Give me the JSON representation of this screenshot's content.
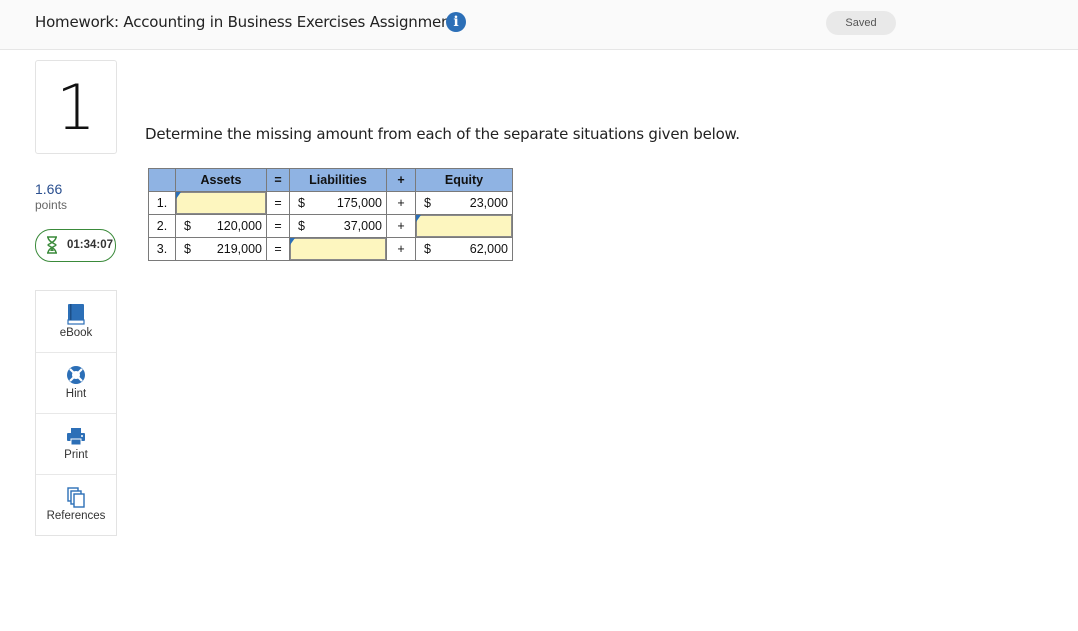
{
  "header": {
    "title": "Homework: Accounting in Business Exercises Assignment",
    "info_icon": "info-icon",
    "saved_label": "Saved"
  },
  "sidebar": {
    "question_number": "1",
    "points_value": "1.66",
    "points_label": "points",
    "timer": "01:34:07",
    "tools": [
      {
        "label": "eBook",
        "icon": "book-icon"
      },
      {
        "label": "Hint",
        "icon": "lifebuoy-icon"
      },
      {
        "label": "Print",
        "icon": "printer-icon"
      },
      {
        "label": "References",
        "icon": "documents-icon"
      }
    ]
  },
  "question": {
    "prompt": "Determine the missing amount from each of the separate situations given below.",
    "table": {
      "headers": {
        "assets": "Assets",
        "eq": "=",
        "liabilities": "Liabilities",
        "plus": "+",
        "equity": "Equity"
      },
      "rows": [
        {
          "num": "1.",
          "assets_cur": "",
          "assets": "",
          "eq": "=",
          "liab_cur": "$",
          "liabilities": "175,000",
          "plus": "+",
          "eq_cur": "$",
          "equity": "23,000"
        },
        {
          "num": "2.",
          "assets_cur": "$",
          "assets": "120,000",
          "eq": "=",
          "liab_cur": "$",
          "liabilities": "37,000",
          "plus": "+",
          "eq_cur": "",
          "equity": ""
        },
        {
          "num": "3.",
          "assets_cur": "$",
          "assets": "219,000",
          "eq": "=",
          "liab_cur": "",
          "liabilities": "",
          "plus": "+",
          "eq_cur": "$",
          "equity": "62,000"
        }
      ]
    }
  },
  "colors": {
    "header_blue": "#8fb3e3",
    "input_yellow": "#fdf6bf",
    "accent_blue": "#2c6fb7",
    "timer_green": "#3a8a3a"
  }
}
